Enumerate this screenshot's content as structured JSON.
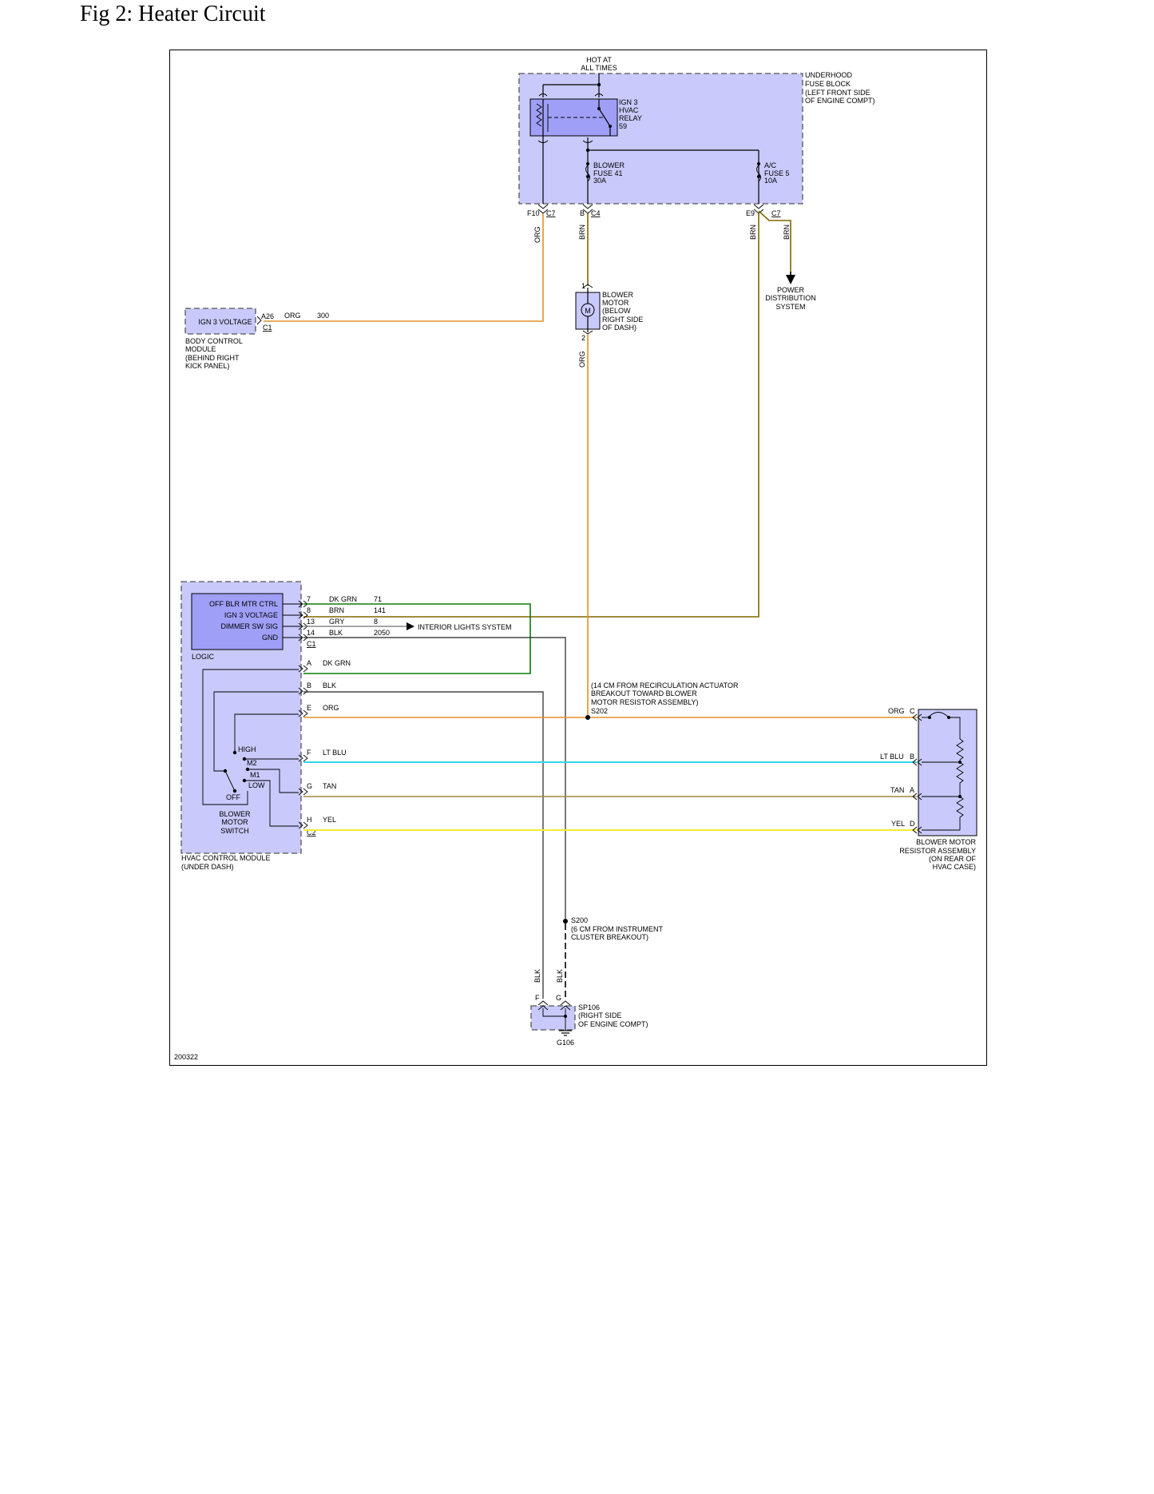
{
  "title": "Fig 2: Heater Circuit",
  "figure_id": "200322",
  "colors": {
    "org": "#e0902a",
    "brn": "#806600",
    "dk_grn": "#0d7a0d",
    "gry": "#888888",
    "blk": "#222222",
    "lt_blu": "#33d6e6",
    "tan": "#9c8a45",
    "yel": "#f2ee30",
    "box_fill": "#c9c9fb",
    "inner_fill": "#9f9ff8"
  },
  "fuse_block": {
    "hot": [
      "HOT AT",
      "ALL TIMES"
    ],
    "label": [
      "UNDERHOOD",
      "FUSE BLOCK",
      "(LEFT FRONT SIDE",
      "OF ENGINE COMPT)"
    ],
    "relay": [
      "IGN 3",
      "HVAC",
      "RELAY",
      "59"
    ],
    "blower_fuse": [
      "BLOWER",
      "FUSE 41",
      "30A"
    ],
    "ac_fuse": [
      "A/C",
      "FUSE 5",
      "10A"
    ],
    "pins": {
      "f10": "F10",
      "c7a": "C7",
      "b": "B",
      "c4": "C4",
      "e9": "E9",
      "c7b": "C7"
    }
  },
  "wires": {
    "org": "ORG",
    "brn": "BRN",
    "blk": "BLK",
    "dk_grn": "DK GRN",
    "gry": "GRY",
    "lt_blu": "LT BLU",
    "tan": "TAN",
    "yel": "YEL"
  },
  "power_dist": [
    "POWER",
    "DISTRIBUTION",
    "SYSTEM"
  ],
  "blower_motor": {
    "label": [
      "BLOWER",
      "MOTOR",
      "(BELOW",
      "RIGHT SIDE",
      "OF DASH)"
    ],
    "symbol": "M",
    "pin1": "1",
    "pin2": "2"
  },
  "bcm": {
    "inner": "IGN 3 VOLTAGE",
    "label": [
      "BODY CONTROL",
      "MODULE",
      "(BEHIND RIGHT",
      "KICK PANEL)"
    ],
    "pin": "A26",
    "conn": "C1",
    "wire": "ORG",
    "circuit": "300"
  },
  "hvac_module": {
    "logic_rows": [
      "OFF BLR MTR CTRL",
      "IGN 3 VOLTAGE",
      "DIMMER SW SIG",
      "GND"
    ],
    "logic_label": "LOGIC",
    "c1_pins": [
      {
        "pin": "7",
        "color": "DK GRN",
        "circuit": "71"
      },
      {
        "pin": "8",
        "color": "BRN",
        "circuit": "141"
      },
      {
        "pin": "13",
        "color": "GRY",
        "circuit": "8"
      },
      {
        "pin": "14",
        "color": "BLK",
        "circuit": "2050"
      }
    ],
    "c1": "C1",
    "interior_lights": "INTERIOR LIGHTS SYSTEM",
    "c2_pins": [
      {
        "pin": "A",
        "color": "DK GRN"
      },
      {
        "pin": "B",
        "color": "BLK"
      },
      {
        "pin": "E",
        "color": "ORG"
      },
      {
        "pin": "F",
        "color": "LT BLU"
      },
      {
        "pin": "G",
        "color": "TAN"
      },
      {
        "pin": "H",
        "color": "YEL"
      }
    ],
    "c2": "C2",
    "switch_positions": [
      "HIGH",
      "M2",
      "M1",
      "LOW",
      "OFF"
    ],
    "switch_label": [
      "BLOWER",
      "MOTOR",
      "SWITCH"
    ],
    "label": [
      "HVAC CONTROL MODULE",
      "(UNDER DASH)"
    ]
  },
  "s202": {
    "note": [
      "(14 CM FROM RECIRCULATION ACTUATOR",
      "BREAKOUT TOWARD BLOWER",
      "MOTOR RESISTOR ASSEMBLY)"
    ],
    "name": "S202"
  },
  "resistor": {
    "pins": [
      {
        "color": "ORG",
        "pin": "C"
      },
      {
        "color": "LT BLU",
        "pin": "B"
      },
      {
        "color": "TAN",
        "pin": "A"
      },
      {
        "color": "YEL",
        "pin": "D"
      }
    ],
    "label": [
      "BLOWER MOTOR",
      "RESISTOR ASSEMBLY",
      "(ON REAR OF",
      "HVAC CASE)"
    ]
  },
  "s200": {
    "name": "S200",
    "note": [
      "(6 CM FROM INSTRUMENT",
      "CLUSTER BREAKOUT)"
    ]
  },
  "sp106": {
    "pin_f": "F",
    "pin_g": "G",
    "label": [
      "SP106",
      "(RIGHT SIDE",
      "OF ENGINE COMPT)"
    ],
    "ground": "G106"
  }
}
